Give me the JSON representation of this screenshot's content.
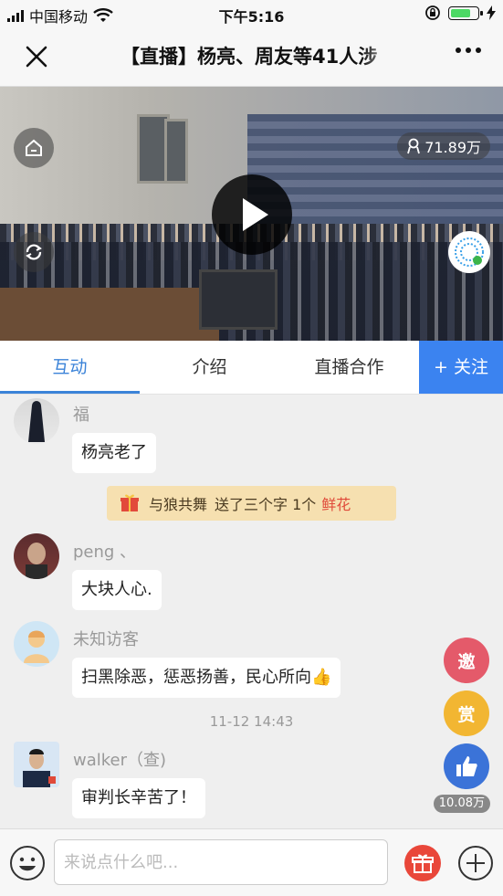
{
  "status_bar": {
    "carrier": "中国移动",
    "time": "下午5:16",
    "battery_percent": 75
  },
  "nav": {
    "title": "【直播】杨亮、周友等41人涉",
    "close_icon": "close-icon",
    "more_icon": "more-icon"
  },
  "video": {
    "viewers": "71.89万",
    "home_icon": "home-icon",
    "rotate_icon": "rotate-icon",
    "play_icon": "play-icon"
  },
  "tabs": [
    {
      "label": "互动",
      "active": true
    },
    {
      "label": "介绍"
    },
    {
      "label": "直播合作"
    }
  ],
  "follow_button": "+ 关注",
  "messages": [
    {
      "user": "福",
      "text": "杨亮老了"
    },
    {
      "user": "peng 、",
      "text": "大块人心."
    },
    {
      "user": "未知访客",
      "text": "扫黑除恶，惩恶扬善，民心所向👍"
    },
    {
      "user": "walker（查)",
      "text": "审判长辛苦了！"
    }
  ],
  "gift_notice": {
    "sender": "与狼共舞",
    "action": "送了三个字 1个",
    "gift": "鲜花"
  },
  "timestamp": "11-12 14:43",
  "side_buttons": {
    "invite": "邀",
    "reward": "赏",
    "like_count": "10.08万"
  },
  "input": {
    "placeholder": "来说点什么吧..."
  },
  "colors": {
    "accent": "#3b83d8",
    "follow": "#3b83f0",
    "gift": "#e9473a"
  }
}
